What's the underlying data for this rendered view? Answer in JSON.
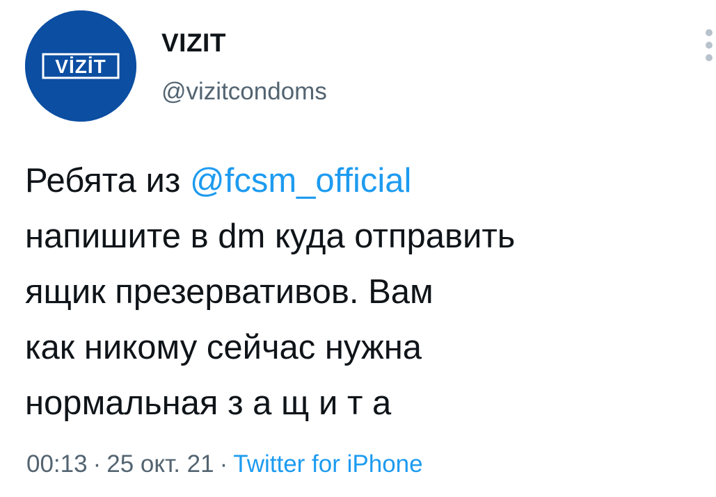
{
  "author": {
    "avatar_logo_text": "VİZİT",
    "display_name": "VIZIT",
    "handle": "@vizitcondoms"
  },
  "tweet": {
    "line1_prefix": "Ребята из ",
    "mention": "@fcsm_official",
    "line2": "напишите в dm куда отправить",
    "line3": "ящик презервативов. Вам",
    "line4": "как никому сейчас нужна",
    "line5": "нормальная з а щ и т а"
  },
  "meta": {
    "time": "00:13",
    "separator1": "·",
    "date": "25 окт. 21",
    "separator2": "·",
    "source": "Twitter for iPhone"
  },
  "icons": {
    "more": "more-vertical-icon"
  },
  "colors": {
    "avatar_bg": "#0b4ea2",
    "link": "#1d9bf0",
    "text": "#0f1419",
    "secondary": "#536471"
  }
}
